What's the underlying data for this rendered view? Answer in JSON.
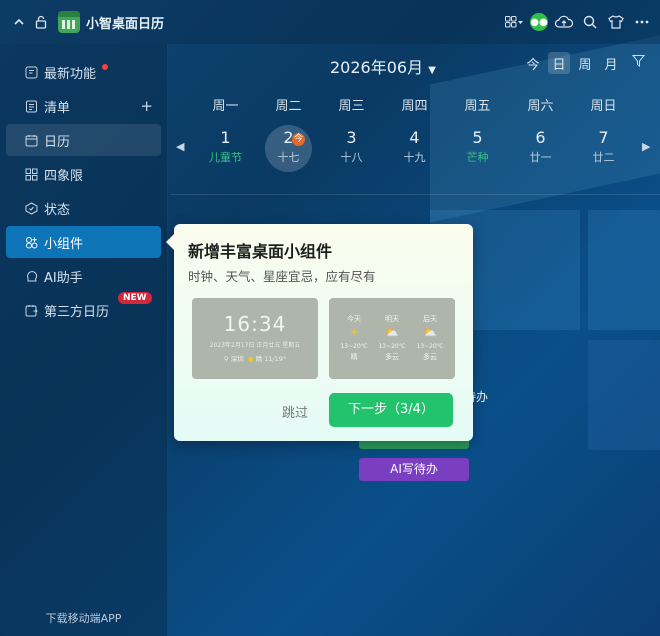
{
  "titlebar": {
    "app_title": "小智桌面日历",
    "icons": [
      "chevron-up-icon",
      "lock-icon",
      "app-logo",
      "grid-apps-icon",
      "wechat-icon",
      "cloud-upload-icon",
      "search-icon",
      "shirt-icon",
      "more-icon"
    ]
  },
  "sidebar": {
    "items": [
      {
        "label": "最新功能",
        "icon": "new-feature-icon"
      },
      {
        "label": "清单",
        "icon": "checklist-icon"
      },
      {
        "label": "日历",
        "icon": "calendar-icon"
      },
      {
        "label": "四象限",
        "icon": "quadrant-icon"
      },
      {
        "label": "状态",
        "icon": "status-icon"
      },
      {
        "label": "小组件",
        "icon": "widget-icon"
      },
      {
        "label": "AI助手",
        "icon": "ai-assistant-icon"
      },
      {
        "label": "第三方日历",
        "icon": "third-party-calendar-icon"
      }
    ],
    "new_badge": "NEW",
    "plus": "+",
    "footer": "下载移动端APP"
  },
  "calendar": {
    "month_title": "2026年06月",
    "views": [
      "今",
      "日",
      "周",
      "月"
    ],
    "weekdays": [
      "周一",
      "周二",
      "周三",
      "周四",
      "周五",
      "周六",
      "周日"
    ],
    "days": [
      {
        "num": "1",
        "sub": "儿童节"
      },
      {
        "num": "2",
        "sub": "十七"
      },
      {
        "num": "3",
        "sub": "十八"
      },
      {
        "num": "4",
        "sub": "十九"
      },
      {
        "num": "5",
        "sub": "芒种"
      },
      {
        "num": "6",
        "sub": "廿一"
      },
      {
        "num": "7",
        "sub": "廿二"
      }
    ],
    "today_badge": "今",
    "colors": {
      "festival": "#35c584",
      "today_badge": "#e06a2a",
      "active": "#0e74b8"
    }
  },
  "behind": {
    "ghost_text": "待办",
    "ai_button": "AI写待办"
  },
  "popup": {
    "title": "新增丰富桌面小组件",
    "subtitle": "时钟、天气、星座宜忌，应有尽有",
    "clock_preview": {
      "time": "16:34",
      "date": "2023年2月17日  正月廿五  星期五",
      "location": "深圳",
      "weather": "晴 11/19°"
    },
    "weather_preview": [
      {
        "day": "今天",
        "temp": "13~20℃",
        "desc": "晴",
        "icon": "sun-icon"
      },
      {
        "day": "明天",
        "temp": "13~20℃",
        "desc": "多云",
        "icon": "partly-cloudy-icon"
      },
      {
        "day": "后天",
        "temp": "13~20℃",
        "desc": "多云",
        "icon": "partly-cloudy-icon"
      }
    ],
    "skip": "跳过",
    "next": "下一步（3/4）"
  }
}
